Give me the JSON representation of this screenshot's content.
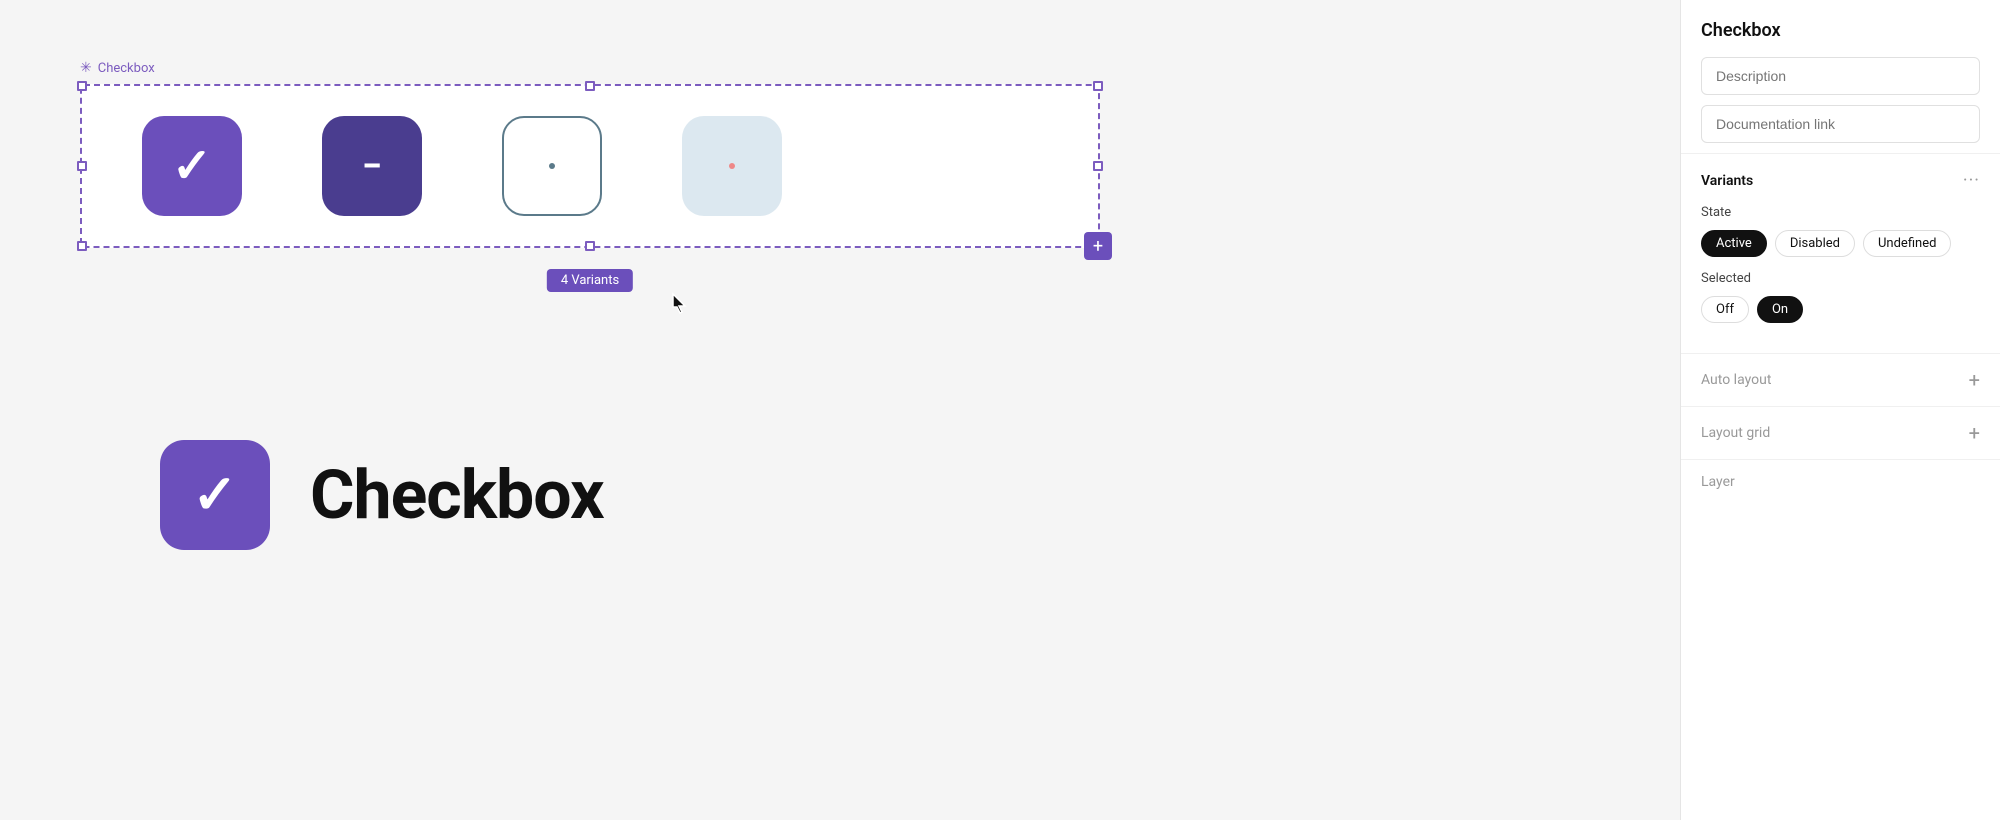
{
  "component": {
    "name": "Checkbox",
    "label": "Checkbox",
    "variants_count": "4 Variants",
    "large_label": "Checkbox"
  },
  "right_panel": {
    "title": "Checkbox",
    "description_placeholder": "Description",
    "doc_link_placeholder": "Documentation link",
    "variants_section": "Variants",
    "state_label": "State",
    "state_pills": [
      {
        "label": "Active",
        "selected": true
      },
      {
        "label": "Disabled",
        "selected": false
      },
      {
        "label": "Undefined",
        "selected": false
      }
    ],
    "selected_label": "Selected",
    "selected_pills": [
      {
        "label": "Off",
        "selected": false
      },
      {
        "label": "On",
        "selected": true
      }
    ],
    "auto_layout_label": "Auto layout",
    "layout_grid_label": "Layout grid",
    "layer_label": "Layer",
    "more_menu": "···"
  },
  "checkboxes": [
    {
      "type": "active-on",
      "icon": "checkmark"
    },
    {
      "type": "active-off",
      "icon": "minus"
    },
    {
      "type": "disabled-on",
      "icon": "dot-teal"
    },
    {
      "type": "disabled-off",
      "icon": "dot-pink"
    }
  ]
}
